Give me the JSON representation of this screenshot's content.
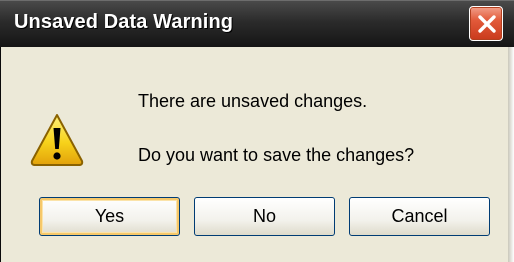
{
  "dialog": {
    "title": "Unsaved Data Warning",
    "message_line1": "There are unsaved changes.",
    "message_line2": "Do you want to save the changes?",
    "icon": "warning-icon"
  },
  "buttons": {
    "yes": "Yes",
    "no": "No",
    "cancel": "Cancel"
  },
  "colors": {
    "titlebar": "#2b2b2b",
    "close_button": "#e25a3a",
    "dialog_background": "#ece9d8",
    "default_button_highlight": "#f6c86a",
    "warning_yellow": "#f7d21b"
  }
}
